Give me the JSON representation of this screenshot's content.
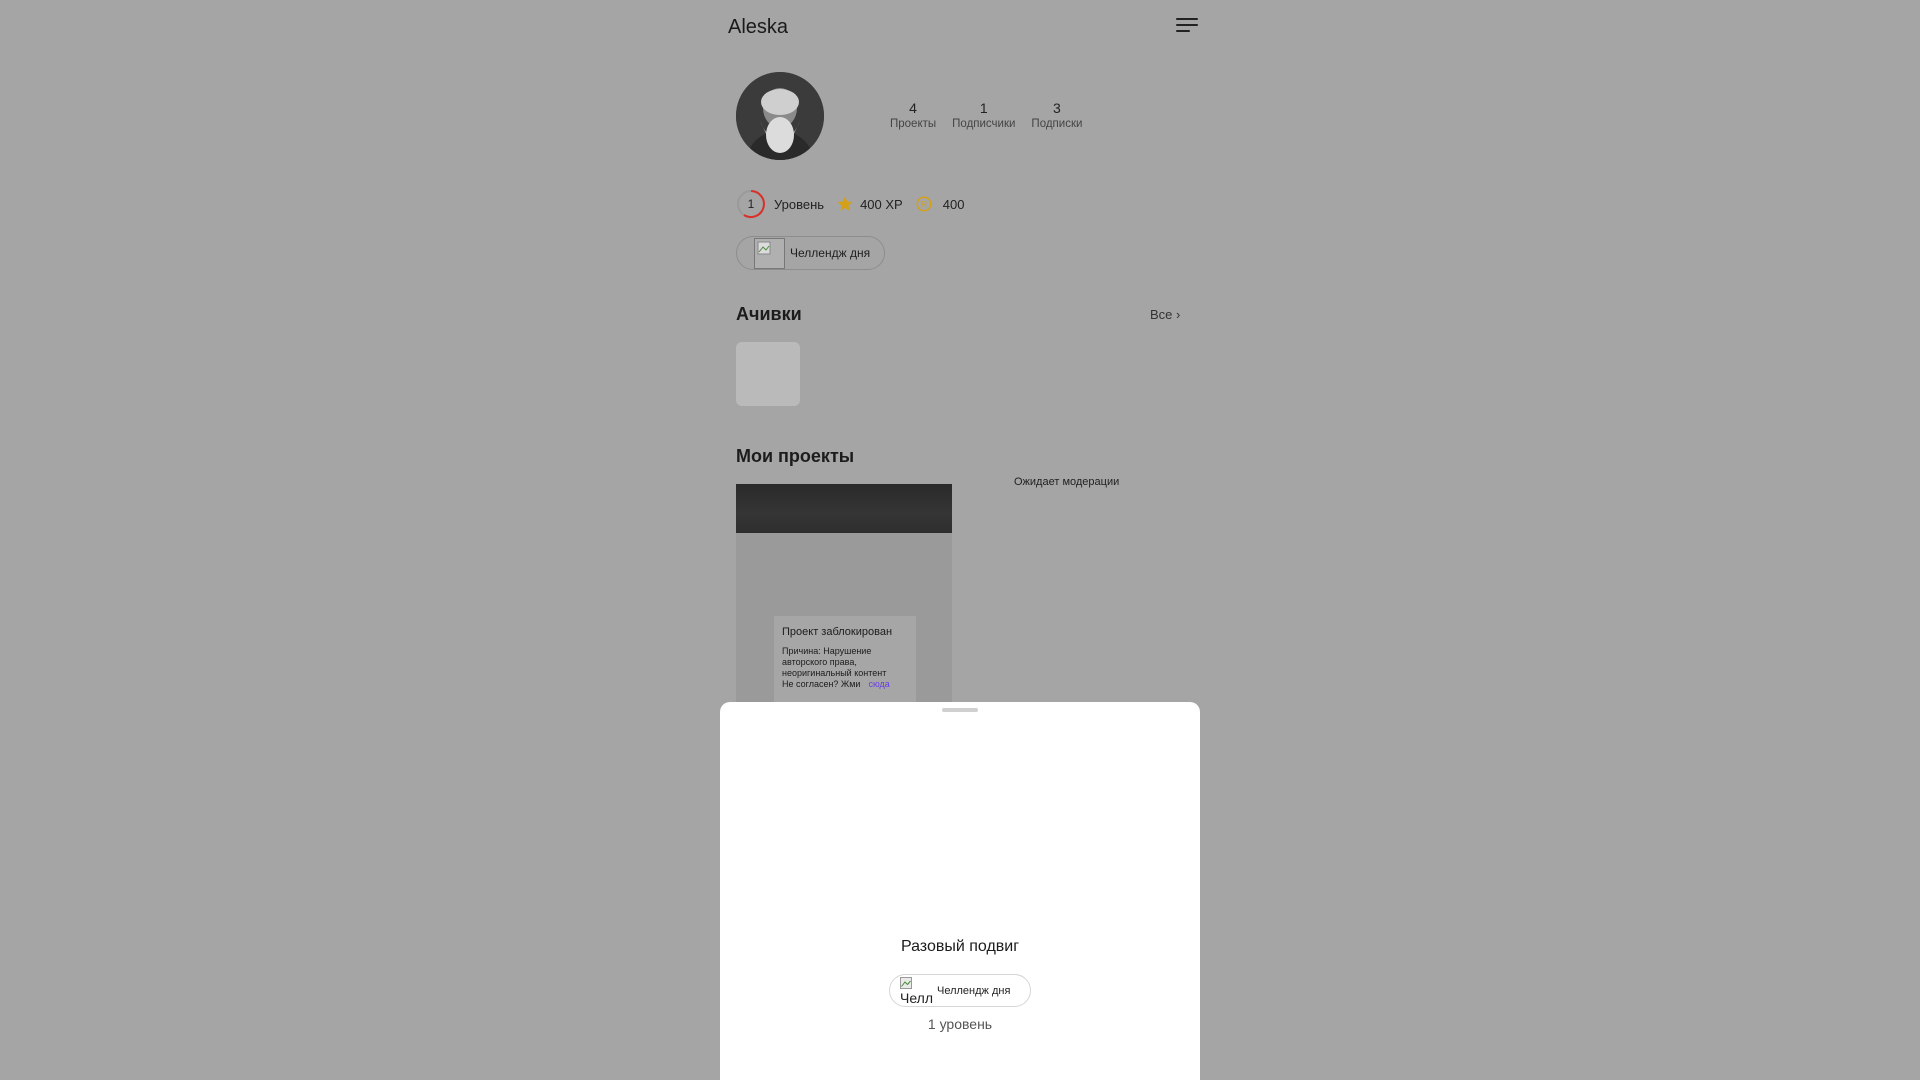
{
  "header": {
    "title": "Aleska",
    "menu_icon": "menu-icon"
  },
  "profile": {
    "stats": [
      {
        "value": "4",
        "label": "Проекты"
      },
      {
        "value": "1",
        "label": "Подписчики"
      },
      {
        "value": "3",
        "label": "Подписки"
      }
    ],
    "level": {
      "number": "1",
      "label": "Уровень",
      "ring_color": "#d9302a"
    },
    "xp": "400 XP",
    "coins": "400",
    "challenge_chip": {
      "label": "Челлендж дня"
    }
  },
  "achievements": {
    "title": "Ачивки",
    "all_link": "Все ›"
  },
  "projects": {
    "title": "Мои проекты",
    "cards": [
      {
        "status_title": "Проект заблокирован",
        "reason_line1": "Причина: Нарушение",
        "reason_line2": "авторского права,",
        "reason_line3": "неоригинальный контент",
        "appeal_text": "Не согласен? Жми",
        "appeal_link": "сюда"
      }
    ],
    "moderation_label": "Ожидает модерации"
  },
  "sheet": {
    "title": "Разовый подвиг",
    "chip_label": "Челлендж дня",
    "chip_alt": "Челл",
    "level_text": "1 уровень"
  },
  "colors": {
    "accent_link": "#6a3fe6",
    "star": "#d4a017",
    "coin": "#d4a017",
    "overlay": "#a5a5a5"
  }
}
